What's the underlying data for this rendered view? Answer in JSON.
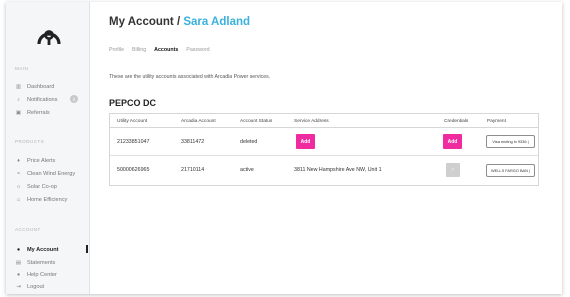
{
  "sidebar": {
    "sections": {
      "main": "MAIN",
      "products": "PRODUCTS",
      "account": "ACCOUNT"
    },
    "main_items": [
      {
        "label": "Dashboard",
        "icon": "bar-chart-icon"
      },
      {
        "label": "Notifications",
        "icon": "bell-icon",
        "badge": "0"
      },
      {
        "label": "Referrals",
        "icon": "gift-icon"
      }
    ],
    "product_items": [
      {
        "label": "Price Alerts",
        "icon": "pin-icon"
      },
      {
        "label": "Clean Wind Energy",
        "icon": "wind-icon"
      },
      {
        "label": "Solar Co-op",
        "icon": "sun-icon"
      },
      {
        "label": "Home Efficiency",
        "icon": "home-icon"
      }
    ],
    "account_items": [
      {
        "label": "My Account",
        "icon": "user-icon",
        "active": true
      },
      {
        "label": "Statements",
        "icon": "document-icon"
      },
      {
        "label": "Help Center",
        "icon": "help-icon"
      },
      {
        "label": "Logout",
        "icon": "logout-icon"
      }
    ]
  },
  "header": {
    "title_prefix": "My Account / ",
    "user_name": "Sara Adland"
  },
  "tabs": [
    {
      "label": "Profile",
      "active": false
    },
    {
      "label": "Billing",
      "active": false
    },
    {
      "label": "Accounts",
      "active": true
    },
    {
      "label": "Password",
      "active": false
    }
  ],
  "intro_text": "These are the utility accounts associated with Arcadia Power services.",
  "utility_name": "PEPCO DC",
  "table": {
    "headers": [
      "Utility Account",
      "Arcadia Account",
      "Account Status",
      "Service Address",
      "Credentials",
      "Payment"
    ],
    "rows": [
      {
        "utility_account": "21233851047",
        "arcadia_account": "33811472",
        "status": "deleted",
        "service_address_button": "Add",
        "credentials_button": "Add",
        "payment": "Visa ending in 9336 |"
      },
      {
        "utility_account": "50000626965",
        "arcadia_account": "21710114",
        "status": "active",
        "service_address": "3811 New Hampshire Ave NW, Unit 1",
        "credentials_check": "✓",
        "payment": "WELLS FARGO BAN |"
      }
    ]
  },
  "colors": {
    "accent_blue": "#39b1dd",
    "accent_pink": "#f02ba0",
    "sidebar_bg": "#f5f6f7"
  }
}
